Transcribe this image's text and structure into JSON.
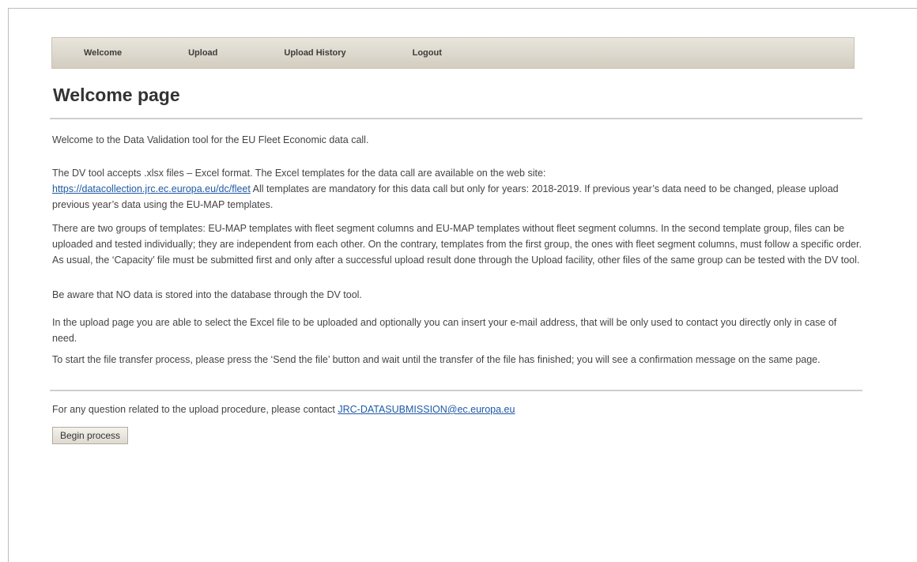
{
  "nav": {
    "items": [
      "Welcome",
      "Upload",
      "Upload History",
      "Logout"
    ]
  },
  "page_title": "Welcome page",
  "intro": "Welcome to the Data Validation tool for the EU Fleet Economic data call.",
  "formats": {
    "text_before": "The DV tool accepts .xlsx files – Excel format. The Excel templates for the data call are available on the web site:",
    "link": "https://datacollection.jrc.ec.europa.eu/dc/fleet",
    "text_after": " All templates are mandatory for this data call but only for years: 2018-2019. If previous year’s data need to be changed, please upload previous year’s data using the EU-MAP templates."
  },
  "templates_info": "There are two groups of templates: EU-MAP templates with fleet segment columns and EU-MAP templates without fleet segment columns. In the second template group, files can be uploaded and tested individually; they are independent from each other. On the contrary, templates from the first group, the ones with fleet segment columns, must follow a specific order. As usual, the ‘Capacity’ file must be submitted first and only after a successful upload result done through the Upload facility, other files of the same group can be tested with the DV tool.",
  "no_data_notice": "Be aware that NO data is stored into the database through the DV tool.",
  "upload_page_info": "In the upload page you are able to select the Excel file to be uploaded and optionally you can insert your e-mail address, that will be only used to contact you directly only in case of need.",
  "transfer_info": "To start the file transfer process, please press the ‘Send the file’ button and wait until the transfer of the file has finished; you will see a confirmation message on the same page.",
  "contact": {
    "text": "For any question related to the upload procedure, please contact ",
    "email": "JRC-DATASUBMISSION@ec.europa.eu"
  },
  "begin_button": "Begin process"
}
